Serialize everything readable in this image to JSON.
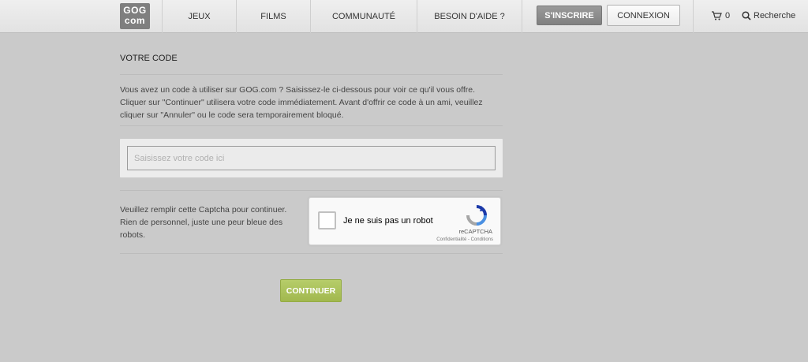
{
  "header": {
    "logo": {
      "line1": "GOG",
      "line2": "com"
    },
    "nav": [
      "JEUX",
      "FILMS",
      "COMMUNAUTÉ",
      "BESOIN D'AIDE ?"
    ],
    "signup_label": "S'INSCRIRE",
    "login_label": "CONNEXION",
    "cart_count": "0",
    "search_label": "Recherche"
  },
  "main": {
    "title": "VOTRE CODE",
    "description": "Vous avez un code à utiliser sur GOG.com ? Saisissez-le ci-dessous pour voir ce qu'il vous offre. Cliquer sur \"Continuer\" utilisera votre code immédiatement. Avant d'offrir ce code à un ami, veuillez cliquer sur \"Annuler\" ou le code sera temporairement bloqué.",
    "code_input": {
      "value": "",
      "placeholder": "Saisissez votre code ici"
    },
    "captcha_text": "Veuillez remplir cette Captcha pour continuer. Rien de personnel, juste une peur bleue des robots.",
    "recaptcha": {
      "label": "Je ne suis pas un robot",
      "brand": "reCAPTCHA",
      "links": "Confidentialité - Conditions"
    },
    "continue_label": "CONTINUER"
  },
  "colors": {
    "background": "#cacaca",
    "header": "#e6e6e6",
    "signup_button": "#8c8c8c",
    "continue_button": "#abc25a"
  }
}
